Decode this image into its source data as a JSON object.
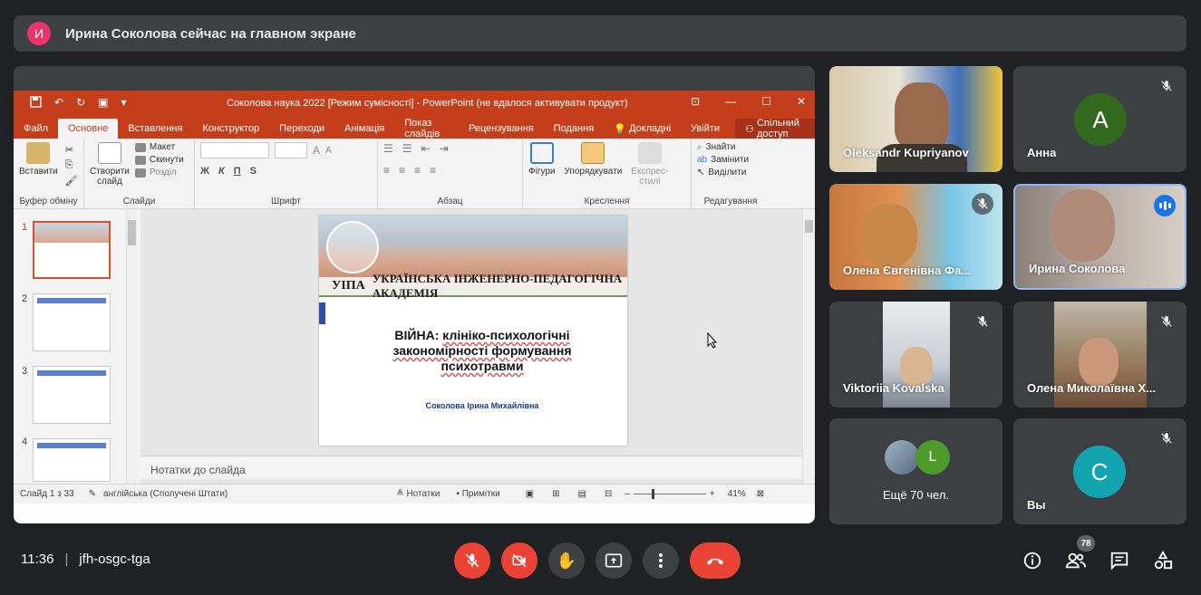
{
  "banner": {
    "avatar_letter": "И",
    "text": "Ирина Соколова сейчас на главном экране"
  },
  "ppt": {
    "window_title": "Соколова наука 2022 [Режим сумісності] - PowerPoint (не вдалося активувати продукт)",
    "tabs": [
      "Файл",
      "Основне",
      "Вставлення",
      "Конструктор",
      "Переходи",
      "Анімація",
      "Показ слайдів",
      "Рецензування",
      "Подання"
    ],
    "tell_me": "Докладні",
    "user": "Увійти",
    "share": "Спільний доступ",
    "ribbon": {
      "clipboard": {
        "paste": "Вставити",
        "label": "Буфер обміну"
      },
      "slides": {
        "new_slide_1": "Створити",
        "new_slide_2": "слайд",
        "layout": "Макет",
        "reset": "Скинути",
        "section": "Розділ",
        "label": "Слайди"
      },
      "font": {
        "bold": "Ж",
        "italic": "К",
        "underline": "П",
        "strike": "S",
        "label": "Шрифт"
      },
      "paragraph": {
        "label": "Абзац"
      },
      "drawing": {
        "shapes": "Фігури",
        "arrange": "Упорядкувати",
        "quick_1": "Експрес-",
        "quick_2": "стилі",
        "label": "Креслення"
      },
      "editing": {
        "find": "Знайти",
        "replace": "Замінити",
        "select": "Виділити",
        "label": "Редагування"
      }
    },
    "thumb_numbers": [
      "1",
      "2",
      "3",
      "4"
    ],
    "slide": {
      "abbr": "УІПА",
      "academy": "УКРАЇНСЬКА ІНЖЕНЕРНО-ПЕДАГОГІЧНА АКАДЕМІЯ",
      "heading_1": "ВІЙНА: ",
      "heading_1b": "клініко-психологічні",
      "heading_2": "закономірності формування",
      "heading_3": "психотравми",
      "author": "Соколова Ірина Михайлівна"
    },
    "notes_placeholder": "Нотатки до слайда",
    "status": {
      "slide_count": "Слайд 1 з 33",
      "language": "англійська (Сполучені Штати)",
      "notes": "Нотатки",
      "comments": "Примітки",
      "zoom": "41%"
    }
  },
  "participants": [
    {
      "name": "Oleksandr Kupriyanov",
      "mic": "on"
    },
    {
      "name": "Анна",
      "avatar_letter": "А",
      "avatar_color": "#33691e",
      "mic": "off"
    },
    {
      "name": "Олена Євгенівна Фа...",
      "mic": "off"
    },
    {
      "name": "Ирина Соколова",
      "mic": "speaking"
    },
    {
      "name": "Viktoriia Kovalska",
      "mic": "off"
    },
    {
      "name": "Олена Миколаївна Х...",
      "mic": "off"
    },
    {
      "name": "Ещё 70 чел.",
      "avatar_letter": "L",
      "avatar_color": "#4e9a2a"
    },
    {
      "name": "Вы",
      "avatar_letter": "С",
      "avatar_color": "#12a4af",
      "mic": "off"
    }
  ],
  "bottom": {
    "time": "11:36",
    "meeting_code": "jfh-osgc-tga",
    "people_count": "78"
  },
  "icons": {
    "mic": "mic-off-icon",
    "camera": "camera-off-icon",
    "hand": "raise-hand-icon",
    "present": "present-screen-icon",
    "more": "more-options-icon",
    "end": "end-call-icon",
    "info": "info-icon",
    "people": "people-icon",
    "chat": "chat-icon",
    "activities": "activities-icon"
  }
}
